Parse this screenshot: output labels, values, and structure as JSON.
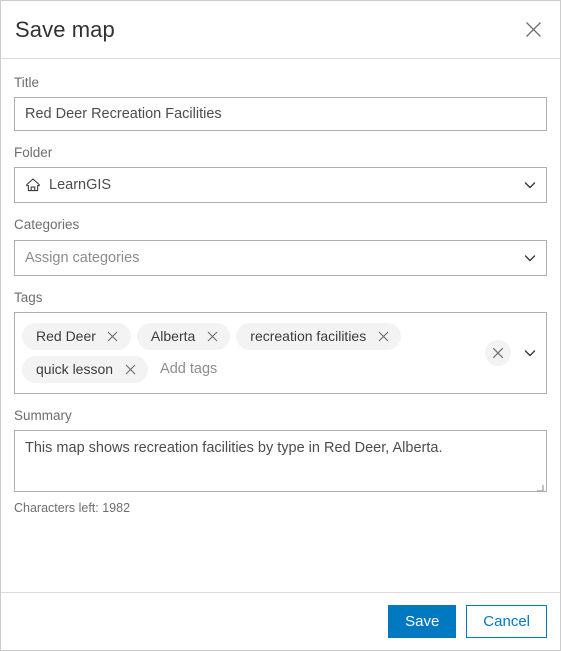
{
  "dialog": {
    "title": "Save map",
    "close_icon": "close-icon"
  },
  "fields": {
    "title": {
      "label": "Title",
      "value": "Red Deer Recreation Facilities"
    },
    "folder": {
      "label": "Folder",
      "value": "LearnGIS",
      "icon": "home-icon",
      "chevron": "chevron-down-icon"
    },
    "categories": {
      "label": "Categories",
      "placeholder": "Assign categories",
      "value": "",
      "chevron": "chevron-down-icon"
    },
    "tags": {
      "label": "Tags",
      "chips": [
        "Red Deer",
        "Alberta",
        "recreation facilities",
        "quick lesson"
      ],
      "placeholder": "Add tags",
      "clear_icon": "close-circle-icon",
      "chevron": "chevron-down-icon"
    },
    "summary": {
      "label": "Summary",
      "value": "This map shows recreation facilities by type in Red Deer, Alberta.",
      "characters_left": "Characters left: 1982"
    }
  },
  "footer": {
    "save_label": "Save",
    "cancel_label": "Cancel"
  },
  "colors": {
    "accent": "#0079c1",
    "chip_bg": "#f3f3f3",
    "border": "#aeaeae",
    "label_text": "#6e6e6e"
  }
}
